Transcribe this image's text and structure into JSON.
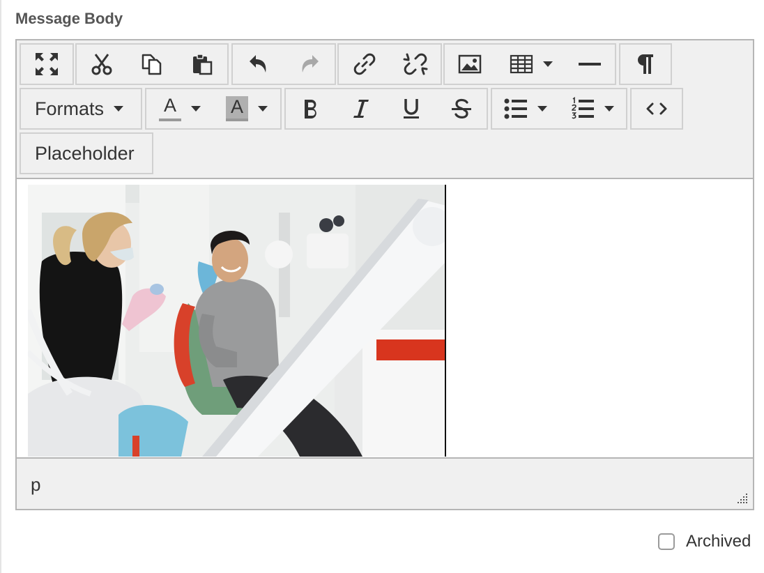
{
  "field_label": "Message Body",
  "toolbar": {
    "formats_label": "Formats",
    "placeholder_label": "Placeholder",
    "text_color_letter": "A",
    "bg_color_letter": "A",
    "icons": [
      "fullscreen-icon",
      "cut-icon",
      "copy-icon",
      "paste-icon",
      "undo-icon",
      "redo-icon",
      "link-icon",
      "unlink-icon",
      "image-icon",
      "table-icon",
      "horizontal-rule-icon",
      "pilcrow-icon",
      "bold-icon",
      "italic-icon",
      "underline-icon",
      "strikethrough-icon",
      "bullet-list-icon",
      "numbered-list-icon",
      "source-code-icon"
    ],
    "disabled": [
      "redo"
    ]
  },
  "content": {
    "image_alt": "Photo of a dentist talking with a smiling patient in a dental chair"
  },
  "statusbar": {
    "path": "p"
  },
  "archived": {
    "label": "Archived",
    "checked": false
  },
  "colors": {
    "toolbar_bg": "#f0f0f0",
    "border": "#b5b5b5",
    "icon": "#333333",
    "icon_disabled": "#a8a8a8",
    "text_color_underline": "#999999",
    "bg_color_swatch": "#b0b0b0"
  }
}
